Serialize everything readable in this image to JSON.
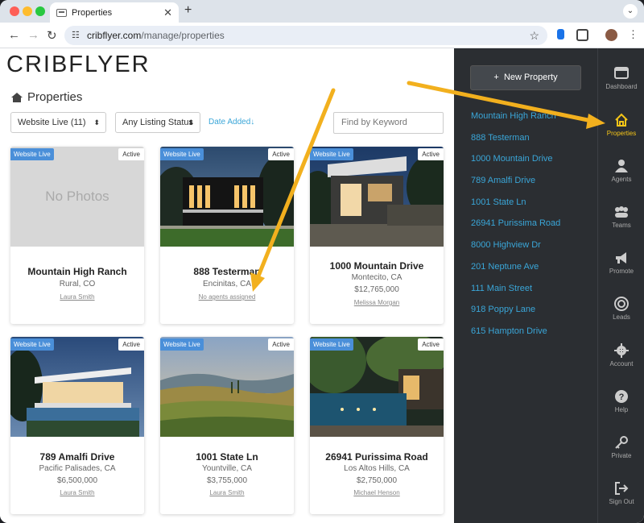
{
  "browser": {
    "tab_title": "Properties",
    "url_host": "cribflyer.com",
    "url_path": "/manage/properties"
  },
  "page": {
    "logo": "CRIBFLYER",
    "title": "Properties",
    "filter_live": "Website Live (11)",
    "filter_status": "Any Listing Status",
    "sort_label": "Date Added↓",
    "keyword_placeholder": "Find by Keyword"
  },
  "badges": {
    "live": "Website Live",
    "active": "Active"
  },
  "cards": [
    {
      "name": "Mountain High Ranch",
      "location": "Rural, CO",
      "price": "",
      "agent": "Laura Smith",
      "photo": "none",
      "no_photo_text": "No Photos"
    },
    {
      "name": "888 Testerman",
      "location": "Encinitas, CA",
      "price": "",
      "agent": "No agents assigned",
      "photo": "modern-night"
    },
    {
      "name": "1000 Mountain Drive",
      "location": "Montecito, CA",
      "price": "$12,765,000",
      "agent": "Melissa Morgan",
      "photo": "hillside-night"
    },
    {
      "name": "789 Amalfi Drive",
      "location": "Pacific Palisades, CA",
      "price": "$6,500,000",
      "agent": "Laura Smith",
      "photo": "pool-dusk"
    },
    {
      "name": "1001 State Ln",
      "location": "Yountville, CA",
      "price": "$3,755,000",
      "agent": "Laura Smith",
      "photo": "vineyard"
    },
    {
      "name": "26941 Purissima Road",
      "location": "Los Altos Hills, CA",
      "price": "$2,750,000",
      "agent": "Michael Henson",
      "photo": "courtyard-pool"
    }
  ],
  "panel": {
    "new_property": "New Property",
    "list": [
      "Mountain High Ranch",
      "888 Testerman",
      "1000 Mountain Drive",
      "789 Amalfi Drive",
      "1001 State Ln",
      "26941 Purissima Road",
      "8000 Highview Dr",
      "201 Neptune Ave",
      "111 Main Street",
      "918 Poppy Lane",
      "615 Hampton Drive"
    ]
  },
  "sidebar": [
    {
      "label": "Dashboard",
      "icon": "dashboard-icon"
    },
    {
      "label": "Properties",
      "icon": "home-icon",
      "active": true
    },
    {
      "label": "Agents",
      "icon": "person-icon"
    },
    {
      "label": "Teams",
      "icon": "group-icon"
    },
    {
      "label": "Promote",
      "icon": "megaphone-icon"
    },
    {
      "label": "Leads",
      "icon": "target-icon"
    },
    {
      "label": "Account",
      "icon": "gear-icon"
    },
    {
      "label": "Help",
      "icon": "help-icon"
    },
    {
      "label": "Private",
      "icon": "key-icon"
    },
    {
      "label": "Sign Out",
      "icon": "sign-out-icon"
    }
  ],
  "colors": {
    "accent": "#3aa6d8",
    "badge": "#4a8fd9",
    "highlight": "#f5c518",
    "panel": "#2b2e32"
  }
}
